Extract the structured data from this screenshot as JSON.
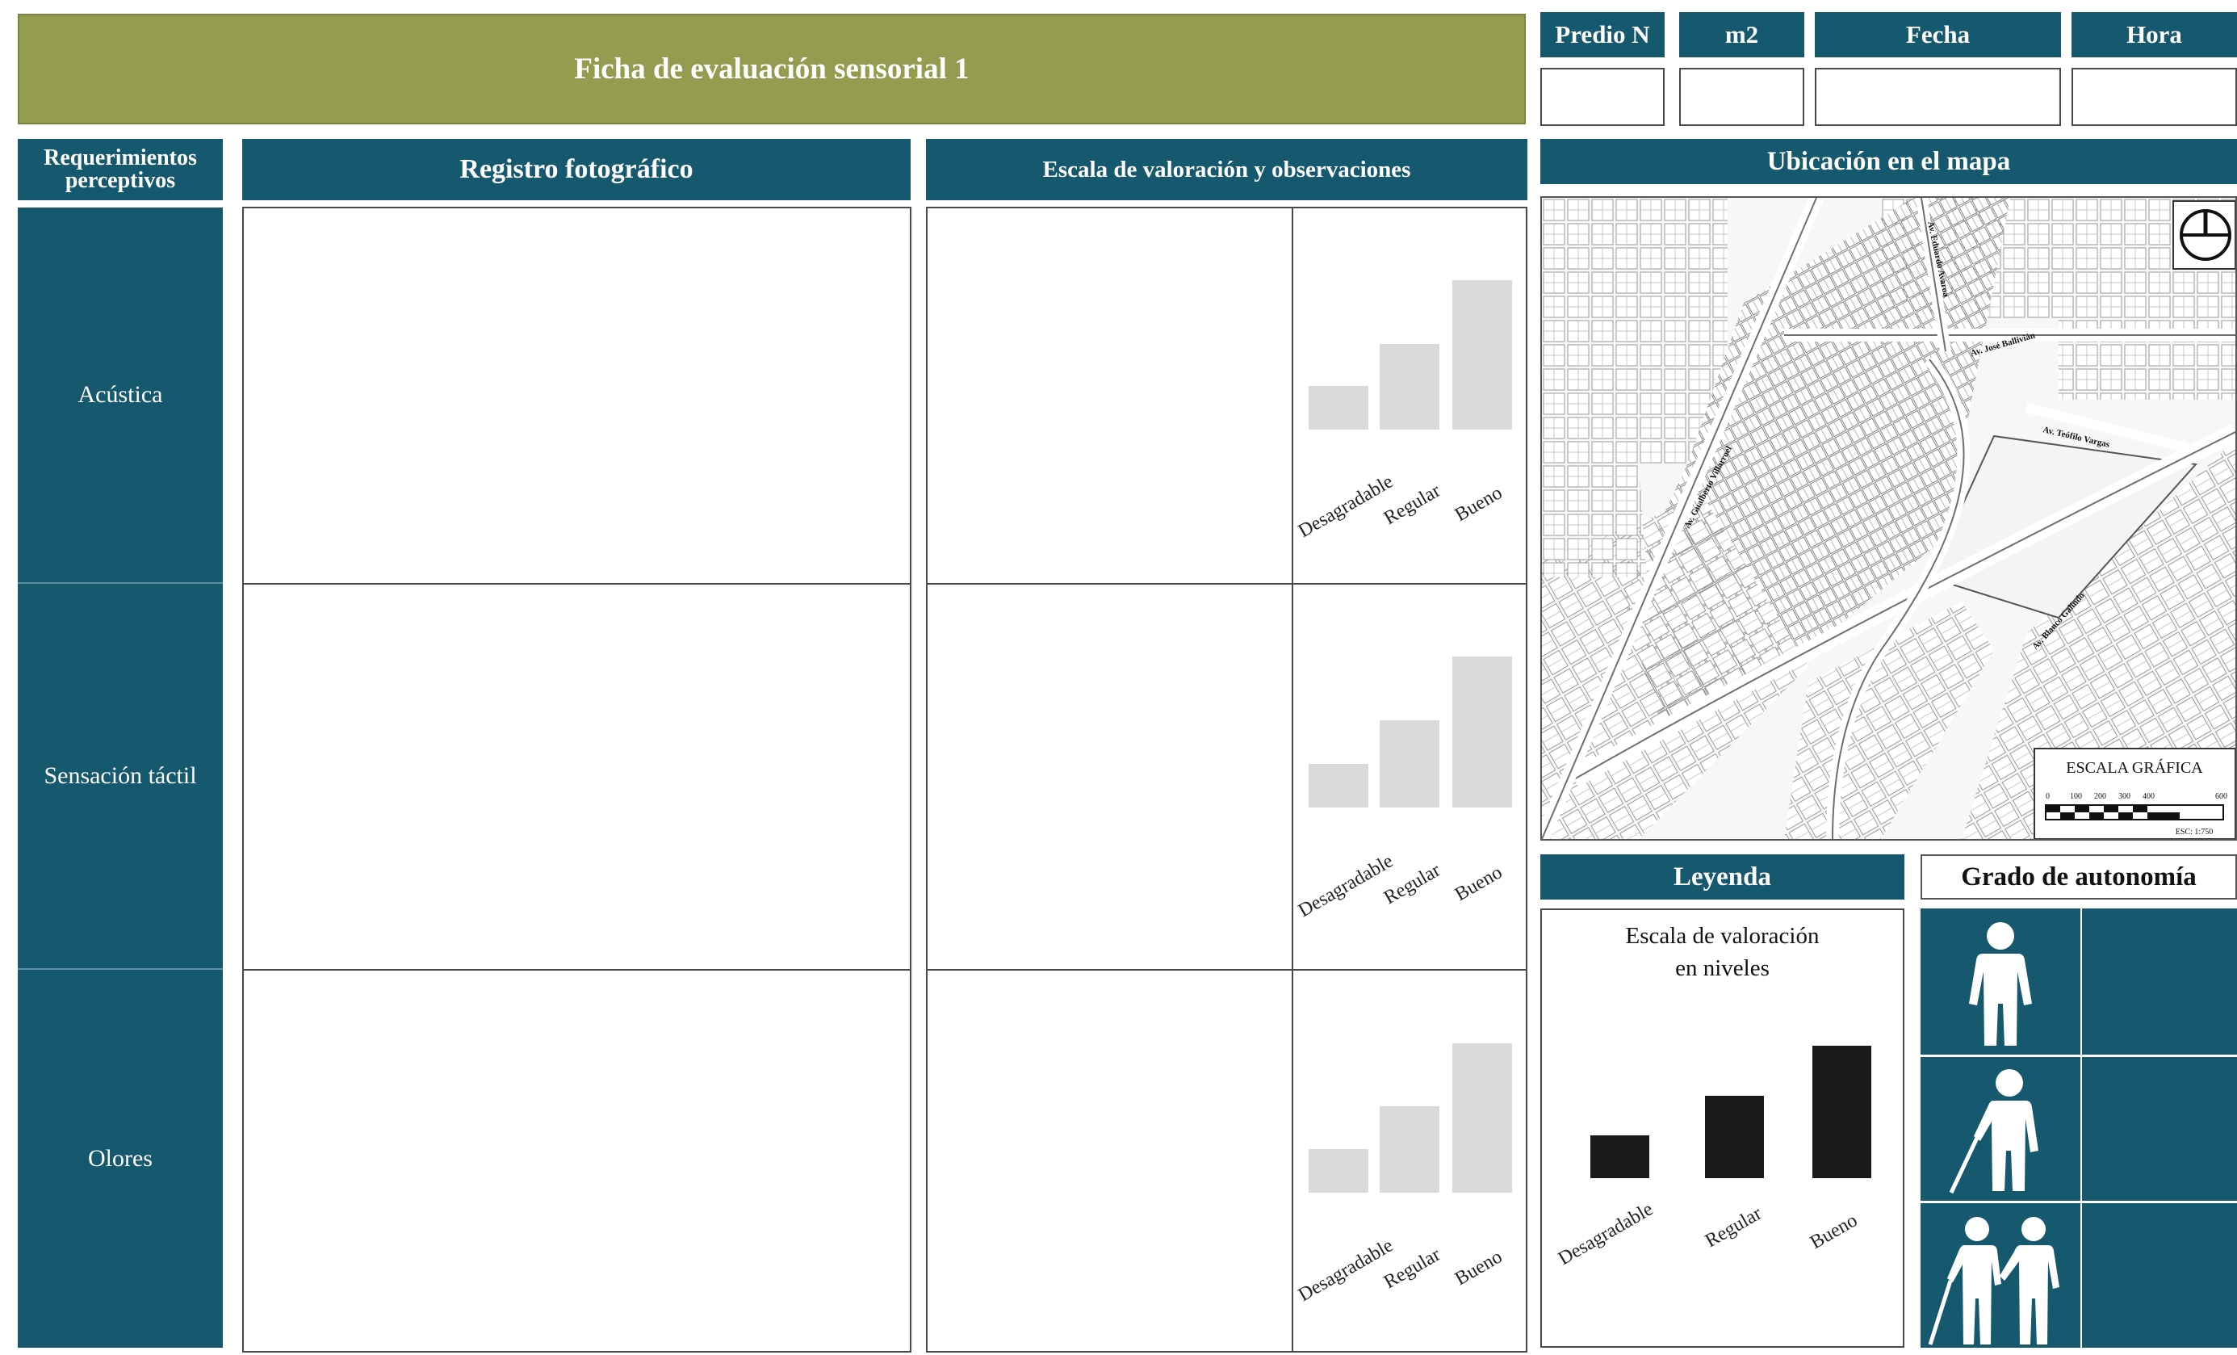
{
  "header": {
    "title": "Ficha de evaluación sensorial 1",
    "fields": [
      {
        "label": "Predio N",
        "value": ""
      },
      {
        "label": "m2",
        "value": ""
      },
      {
        "label": "Fecha",
        "value": ""
      },
      {
        "label": "Hora",
        "value": ""
      }
    ]
  },
  "columns": {
    "requirements": "Requerimientos perceptivos",
    "photo": "Registro fotográfico",
    "scale": "Escala de valoración y observaciones",
    "map": "Ubicación en el mapa"
  },
  "rows": [
    {
      "label": "Acústica",
      "observations": ""
    },
    {
      "label": "Sensación táctil",
      "observations": ""
    },
    {
      "label": "Olores",
      "observations": ""
    }
  ],
  "scale_levels": [
    "Desagradable",
    "Regular",
    "Bueno"
  ],
  "colors": {
    "teal": "#16596f",
    "olive": "#939c4f",
    "bar_gray": "#d9d9d9",
    "bar_black": "#1a1a1a"
  },
  "map": {
    "street_labels": [
      "Av. Eduardo Avaroa",
      "Av. José Ballivián",
      "Av. Gualberto Villarroel",
      "Av. Teófilo Vargas",
      "Av. Blanco Galindo"
    ],
    "compass_icon": "north-arrow-icon",
    "scale_bar": {
      "title": "ESCALA GRÁFICA",
      "ticks": [
        "0",
        "100",
        "200",
        "300",
        "400",
        "600"
      ],
      "note": "ESC: 1:750"
    }
  },
  "legend": {
    "title": "Leyenda",
    "scale_title_line1": "Escala de valoración",
    "scale_title_line2": "en niveles"
  },
  "autonomy": {
    "title": "Grado de autonomía",
    "levels": [
      {
        "icon": "person-standing-icon",
        "value": ""
      },
      {
        "icon": "person-with-cane-icon",
        "value": ""
      },
      {
        "icon": "person-with-companion-icon",
        "value": ""
      }
    ]
  }
}
